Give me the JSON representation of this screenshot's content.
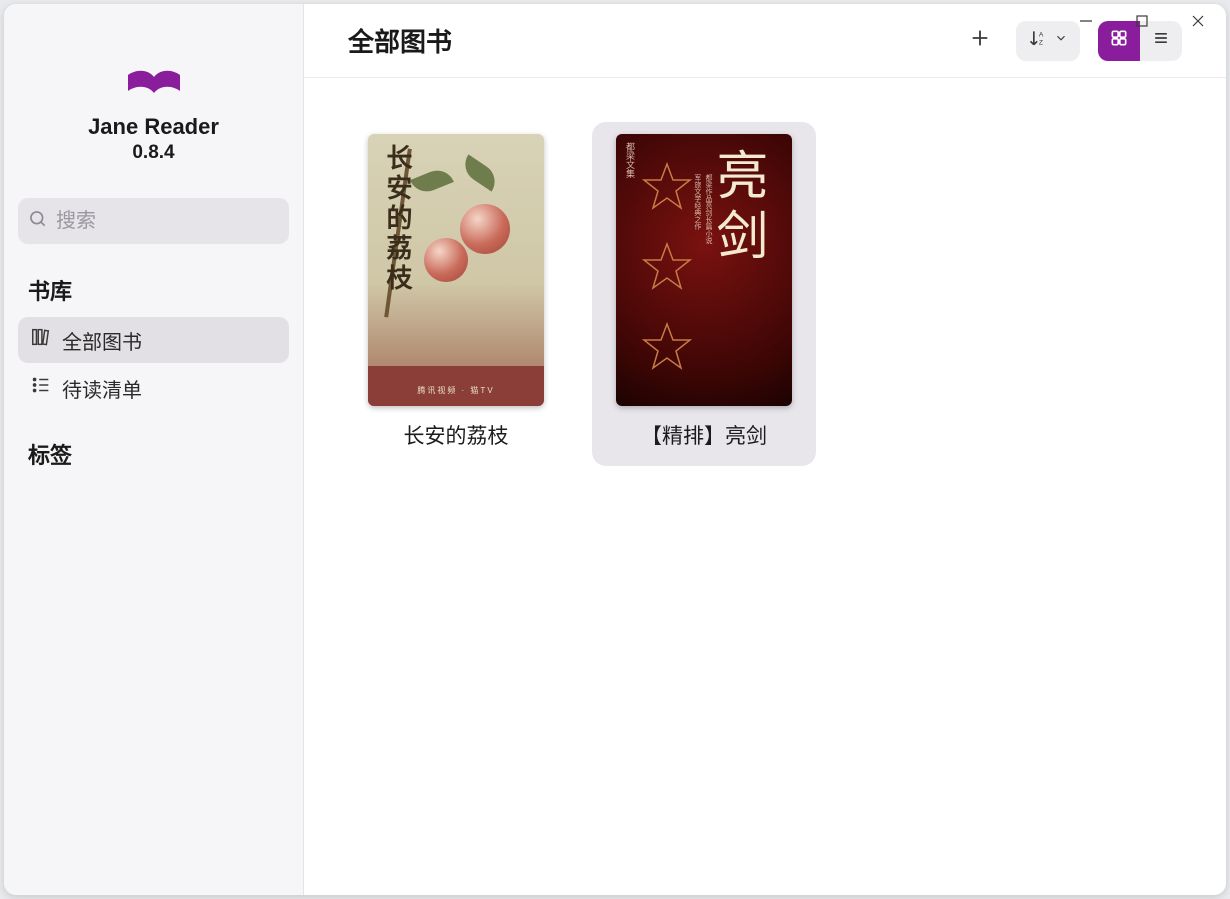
{
  "app": {
    "name": "Jane Reader",
    "version": "0.8.4"
  },
  "search": {
    "placeholder": "搜索"
  },
  "sidebar": {
    "section_library": "书库",
    "section_tags": "标签",
    "items": [
      {
        "label": "全部图书"
      },
      {
        "label": "待读清单"
      }
    ]
  },
  "page": {
    "title": "全部图书"
  },
  "books": [
    {
      "title": "长安的荔枝",
      "cover_text": "长安的荔枝"
    },
    {
      "title": "【精排】亮剑",
      "cover_text": "亮剑",
      "cover_tag": "都梁文集"
    }
  ]
}
